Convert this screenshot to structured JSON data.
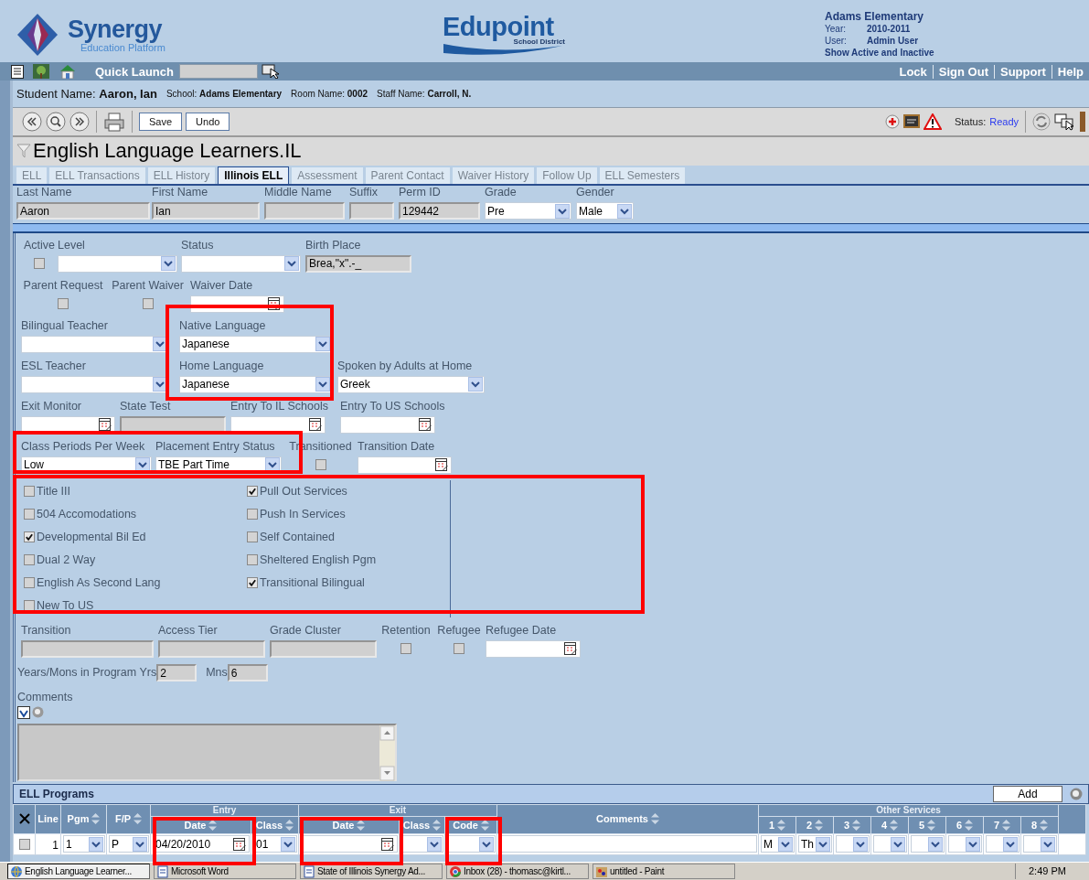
{
  "header": {
    "logo_title": "Synergy",
    "logo_subtitle": "Education Platform",
    "district_title": "Edupoint",
    "district_subtitle": "School District",
    "school": "Adams Elementary",
    "info": [
      {
        "label": "Year:",
        "value": "2010-2011"
      },
      {
        "label": "User:",
        "value": "Admin User"
      }
    ],
    "filter_link": "Show Active and Inactive"
  },
  "nav": {
    "quick_launch": "Quick Launch",
    "links": [
      "Lock",
      "Sign Out",
      "Support",
      "Help"
    ]
  },
  "student_bar": [
    "Student Name: **Aaron, Ian**",
    "School: **Adams Elementary**",
    "Room Name: **0002**",
    "Staff Name: **Carroll, N.**"
  ],
  "toolbar": {
    "buttons": [
      "Save",
      "Undo"
    ],
    "status_label": "Status:",
    "status_value": "Ready"
  },
  "page_title": "English Language Learners.IL",
  "tabs": [
    {
      "label": "ELL",
      "selected": false
    },
    {
      "label": "ELL Transactions",
      "selected": false
    },
    {
      "label": "ELL History",
      "selected": false
    },
    {
      "label": "Illinois ELL",
      "selected": true
    },
    {
      "label": "Assessment",
      "selected": false
    },
    {
      "label": "Parent Contact",
      "selected": false
    },
    {
      "label": "Waiver History",
      "selected": false
    },
    {
      "label": "Follow Up",
      "selected": false
    },
    {
      "label": "ELL Semesters",
      "selected": false
    }
  ],
  "student_fields": [
    {
      "kind": "readonly",
      "label": "Last Name",
      "value": "Aaron"
    },
    {
      "kind": "readonly",
      "label": "First Name",
      "value": "Ian"
    },
    {
      "kind": "readonly",
      "label": "Middle Name"
    },
    {
      "kind": "readonly",
      "label": "Suffix"
    },
    {
      "kind": "readonly",
      "label": "Perm ID",
      "value": "129442"
    },
    {
      "kind": "select",
      "label": "Grade",
      "value": "Pre"
    },
    {
      "kind": "select",
      "label": "Gender",
      "value": "Male"
    }
  ],
  "form": {
    "rows": [
      {
        "fields": [
          {
            "kind": "checkbox",
            "label": "Active",
            "checked": false
          },
          {
            "kind": "select",
            "label": "Level"
          },
          {
            "kind": "select",
            "label": "Status"
          },
          {
            "kind": "readonly",
            "label": "Birth Place",
            "value": "Brea,\"x\".-_"
          }
        ]
      },
      {
        "fields": [
          {
            "kind": "checkbox",
            "label": "Parent Request",
            "checked": false
          },
          {
            "kind": "checkbox",
            "label": "Parent Waiver",
            "checked": false
          },
          {
            "kind": "date",
            "label": "Waiver Date"
          }
        ]
      },
      {
        "fields": [
          {
            "kind": "select",
            "label": "Bilingual Teacher"
          },
          {
            "kind": "select",
            "label": "Native Language",
            "value": "Japanese"
          }
        ]
      },
      {
        "fields": [
          {
            "kind": "select",
            "label": "ESL Teacher"
          },
          {
            "kind": "select",
            "label": "Home Language",
            "value": "Japanese"
          },
          {
            "kind": "select",
            "label": "Spoken by Adults at Home",
            "value": "Greek"
          }
        ]
      },
      {
        "fields": [
          {
            "kind": "date",
            "label": "Exit Monitor"
          },
          {
            "kind": "readonly",
            "label": "State Test"
          },
          {
            "kind": "date",
            "label": "Entry To IL Schools"
          },
          {
            "kind": "date",
            "label": "Entry To US Schools"
          }
        ]
      },
      {
        "fields": [
          {
            "kind": "select",
            "label": "Class Periods Per Week",
            "value": "Low"
          },
          {
            "kind": "select",
            "label": "Placement Entry Status",
            "value": "TBE Part Time"
          },
          {
            "kind": "checkbox",
            "label": "Transitioned",
            "checked": false
          },
          {
            "kind": "date",
            "label": "Transition Date"
          }
        ]
      }
    ],
    "program_columns": [
      [
        {
          "label": "Title III",
          "checked": false
        },
        {
          "label": "504 Accomodations",
          "checked": false
        },
        {
          "label": "Developmental Bil Ed",
          "checked": true
        },
        {
          "label": "Dual 2 Way",
          "checked": false
        },
        {
          "label": "English As Second Lang",
          "checked": false
        },
        {
          "label": "New To US",
          "checked": false
        }
      ],
      [
        {
          "label": "Pull Out Services",
          "checked": true
        },
        {
          "label": "Push In Services",
          "checked": false
        },
        {
          "label": "Self Contained",
          "checked": false
        },
        {
          "label": "Sheltered English Pgm",
          "checked": false
        },
        {
          "label": "Transitional Bilingual",
          "checked": true
        }
      ]
    ],
    "rows_after": [
      {
        "fields": [
          {
            "kind": "readonly",
            "label": "Transition"
          },
          {
            "kind": "readonly",
            "label": "Access Tier"
          },
          {
            "kind": "readonly",
            "label": "Grade Cluster"
          },
          {
            "kind": "checkbox",
            "label": "Retention",
            "checked": false
          },
          {
            "kind": "checkbox",
            "label": "Refugee",
            "checked": false
          },
          {
            "kind": "date",
            "label": "Refugee Date"
          }
        ]
      }
    ],
    "years_label": "Years/Mons in Program Yrs",
    "years_value": "2",
    "months_label": "Mns",
    "months_value": "6",
    "comments_label": "Comments"
  },
  "ell_programs": {
    "title": "ELL Programs",
    "add_button": "Add",
    "header_groups": [
      {
        "label": "Entry"
      },
      {
        "label": "Exit"
      },
      {
        "label": "Other Services"
      }
    ],
    "columns": [
      {
        "label": "Line",
        "sortable": false
      },
      {
        "label": "Pgm",
        "sortable": true
      },
      {
        "label": "F/P",
        "sortable": true
      },
      {
        "label": "Date",
        "sortable": true
      },
      {
        "label": "Class",
        "sortable": true
      },
      {
        "label": "Date",
        "sortable": true
      },
      {
        "label": "Class",
        "sortable": true
      },
      {
        "label": "Code",
        "sortable": true
      },
      {
        "label": "Comments",
        "sortable": true
      },
      {
        "label": "1",
        "sortable": true
      },
      {
        "label": "2",
        "sortable": true
      },
      {
        "label": "3",
        "sortable": true
      },
      {
        "label": "4",
        "sortable": true
      },
      {
        "label": "5",
        "sortable": true
      },
      {
        "label": "6",
        "sortable": true
      },
      {
        "label": "7",
        "sortable": true
      },
      {
        "label": "8",
        "sortable": true
      }
    ],
    "rows": [
      {
        "checked": false,
        "cells": [
          {
            "kind": "label",
            "value": "1"
          },
          {
            "kind": "select",
            "value": "1"
          },
          {
            "kind": "select",
            "value": "P"
          },
          {
            "kind": "date",
            "value": "04/20/2010"
          },
          {
            "kind": "select",
            "value": "01"
          },
          {
            "kind": "date"
          },
          {
            "kind": "select"
          },
          {
            "kind": "select"
          },
          {
            "kind": "input"
          },
          {
            "kind": "select",
            "value": "M"
          },
          {
            "kind": "select",
            "value": "Th"
          },
          {
            "kind": "select"
          },
          {
            "kind": "select"
          },
          {
            "kind": "select"
          },
          {
            "kind": "select"
          },
          {
            "kind": "select"
          },
          {
            "kind": "select"
          }
        ]
      }
    ]
  },
  "annotations": [
    {
      "kind": "box"
    },
    {
      "kind": "box"
    },
    {
      "kind": "box"
    },
    {
      "kind": "box"
    },
    {
      "kind": "box"
    },
    {
      "kind": "box"
    }
  ],
  "taskbar": {
    "items": [
      {
        "label": "English Language Learner...",
        "selected": true
      },
      {
        "label": "Microsoft Word",
        "selected": false
      },
      {
        "label": "State of Illinois Synergy Ad...",
        "selected": false
      },
      {
        "label": "Inbox (28) - thomasc@kirtl...",
        "selected": false
      },
      {
        "label": "untitled - Paint",
        "selected": false
      }
    ],
    "clock": "2:49 PM"
  }
}
